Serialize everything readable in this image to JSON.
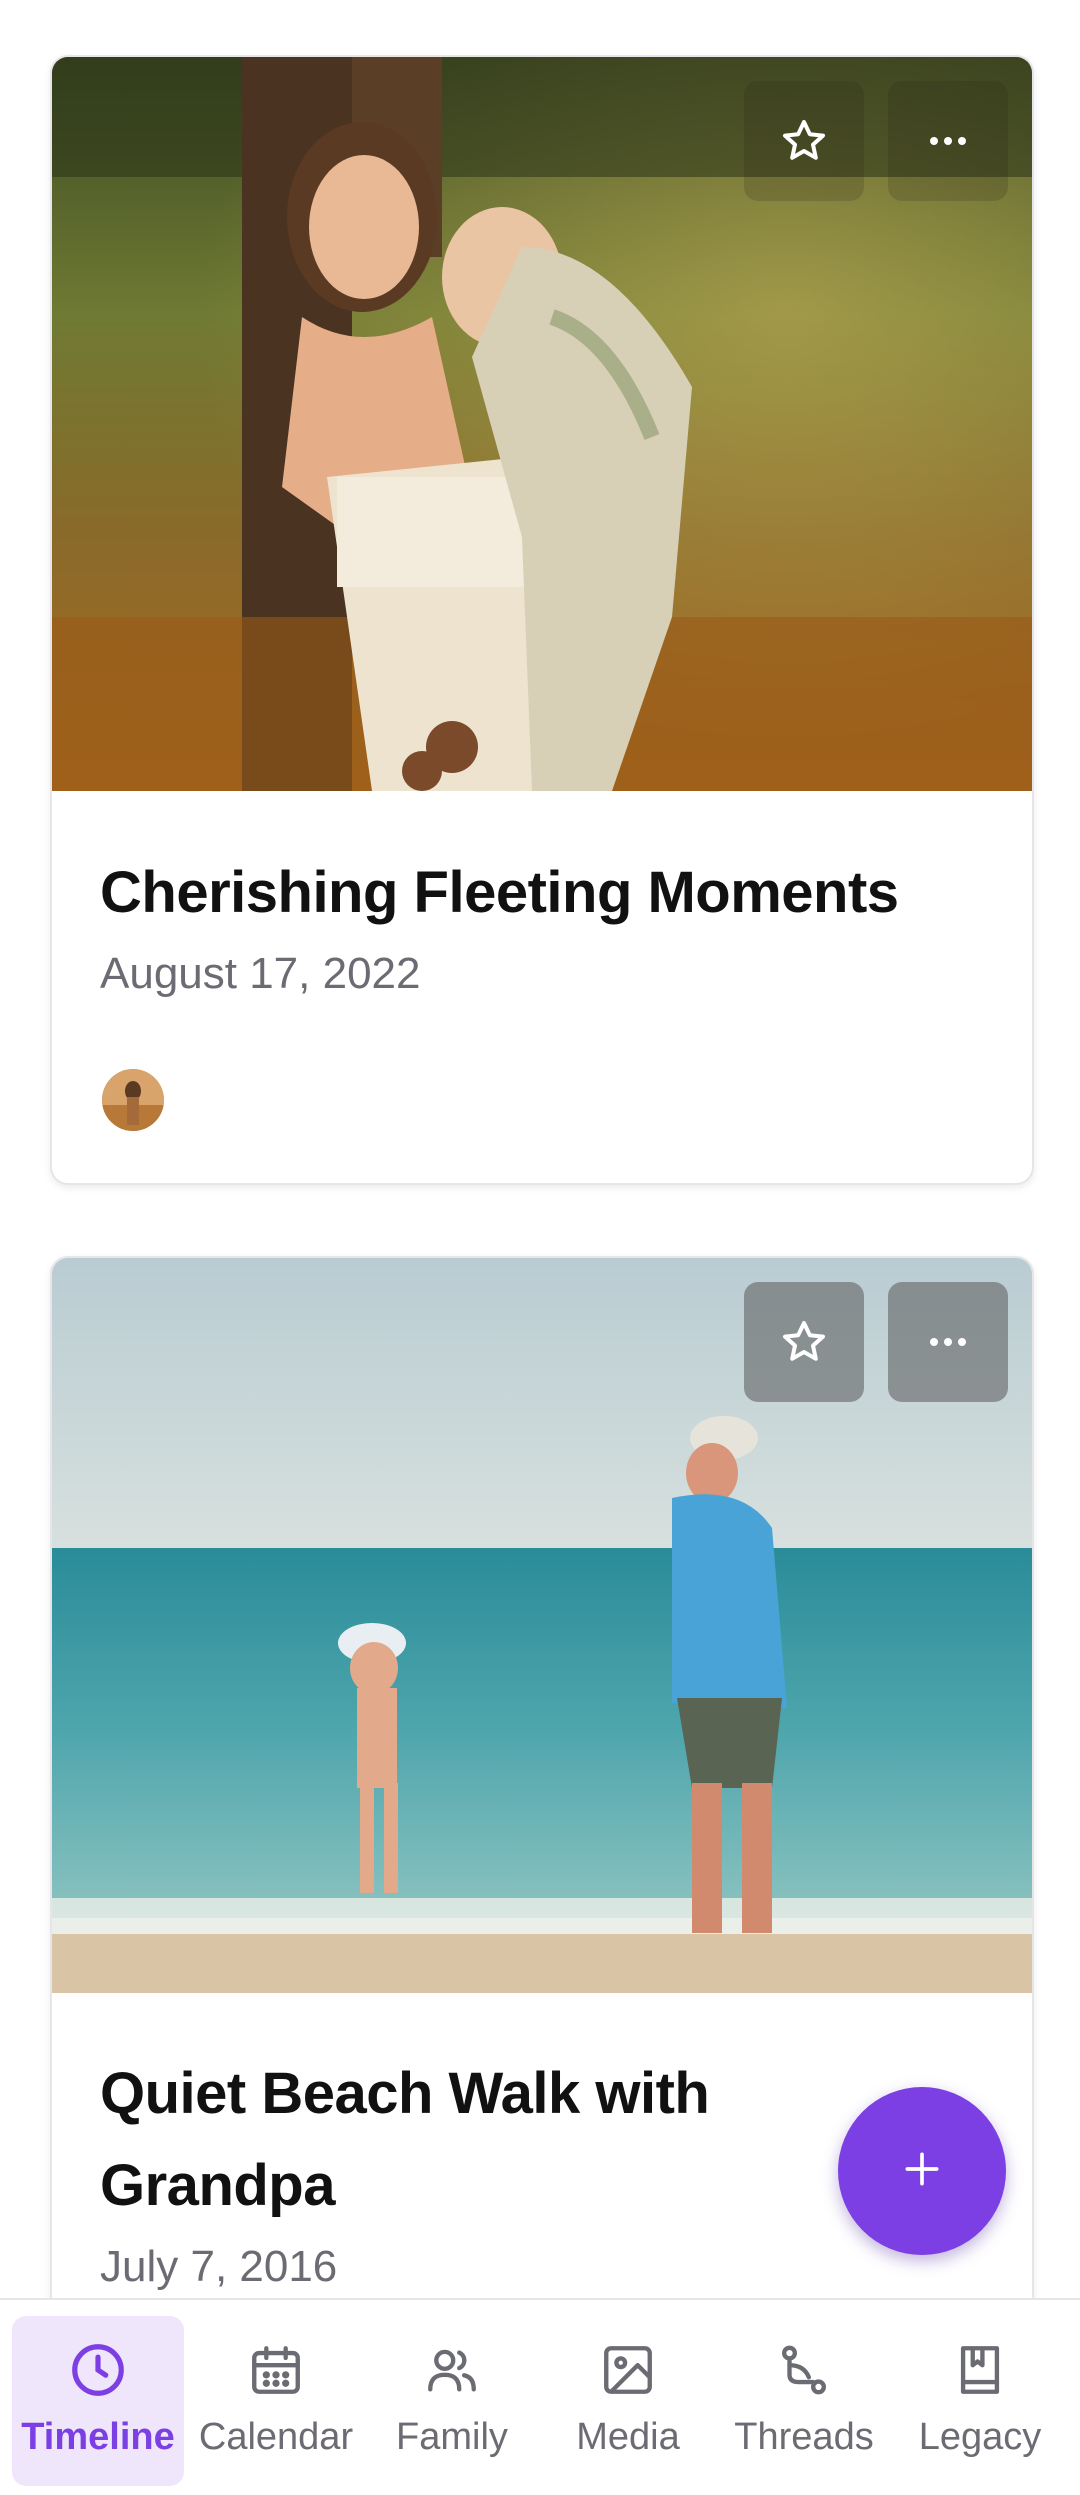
{
  "theme": {
    "accent": "#7b3fe4",
    "active_bg": "#efe6fb",
    "muted": "#6b6b73"
  },
  "cards": [
    {
      "title": "Cherishing Fleeting Moments",
      "date": "August 17, 2022",
      "photo": "mother-holding-child-in-park",
      "has_avatar": true
    },
    {
      "title": "Quiet Beach Walk with Grandpa",
      "date": "July 7, 2016",
      "photo": "grandpa-and-child-on-beach"
    }
  ],
  "overlay_icons": {
    "favorite": "star-icon",
    "more": "more-horizontal-icon"
  },
  "fab": {
    "icon": "plus-icon"
  },
  "nav": {
    "items": [
      {
        "label": "Timeline",
        "icon": "clock-icon",
        "active": true
      },
      {
        "label": "Calendar",
        "icon": "calendar-icon"
      },
      {
        "label": "Family",
        "icon": "users-icon"
      },
      {
        "label": "Media",
        "icon": "image-icon"
      },
      {
        "label": "Threads",
        "icon": "route-icon"
      },
      {
        "label": "Legacy",
        "icon": "bookmark-book-icon"
      }
    ]
  }
}
